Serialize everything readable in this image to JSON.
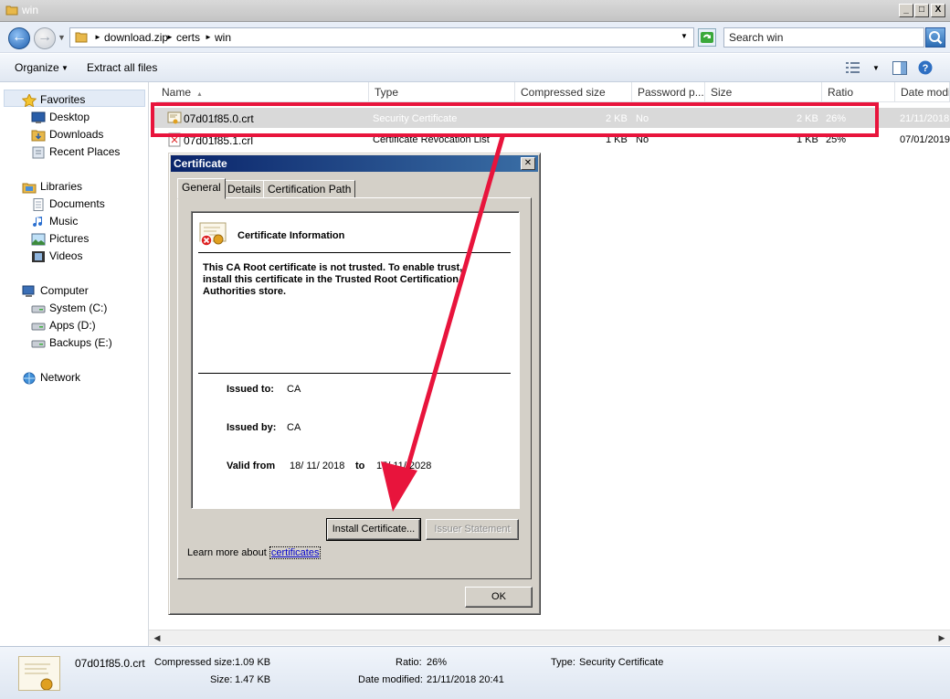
{
  "window": {
    "title": "win"
  },
  "window_controls": {
    "minimize": "_",
    "maximize": "□",
    "close": "X"
  },
  "address": {
    "crumbs": [
      "download.zip",
      "certs",
      "win"
    ],
    "search_placeholder": "Search win"
  },
  "toolbar": {
    "organize": "Organize",
    "extract": "Extract all files"
  },
  "nav": {
    "favorites": "Favorites",
    "favorites_items": [
      "Desktop",
      "Downloads",
      "Recent Places"
    ],
    "libraries": "Libraries",
    "libraries_items": [
      "Documents",
      "Music",
      "Pictures",
      "Videos"
    ],
    "computer": "Computer",
    "computer_items": [
      "System (C:)",
      "Apps (D:)",
      "Backups (E:)"
    ],
    "network": "Network"
  },
  "columns": [
    "Name",
    "Type",
    "Compressed size",
    "Password p...",
    "Size",
    "Ratio",
    "Date modif"
  ],
  "files": [
    {
      "name": "07d01f85.0.crt",
      "type": "Security Certificate",
      "compressed": "2 KB",
      "password": "No",
      "size": "2 KB",
      "ratio": "26%",
      "date": "21/11/2018"
    },
    {
      "name": "07d01f85.1.crl",
      "type": "Certificate Revocation List",
      "compressed": "1 KB",
      "password": "No",
      "size": "1 KB",
      "ratio": "25%",
      "date": "07/01/2019"
    }
  ],
  "details": {
    "filename": "07d01f85.0.crt",
    "compressed_label": "Compressed size:",
    "compressed": "1.09 KB",
    "size_label": "Size:",
    "size": "1.47 KB",
    "ratio_label": "Ratio:",
    "ratio": "26%",
    "date_label": "Date modified:",
    "date": "21/11/2018 20:41",
    "type_label": "Type:",
    "type": "Security Certificate"
  },
  "dialog": {
    "title": "Certificate",
    "tabs": [
      "General",
      "Details",
      "Certification Path"
    ],
    "info_heading": "Certificate Information",
    "warning_lines": [
      "This CA Root certificate is not trusted. To enable trust,",
      "install this certificate in the Trusted Root Certification",
      "Authorities store."
    ],
    "issued_to_label": "Issued to:",
    "issued_to": "CA",
    "issued_by_label": "Issued by:",
    "issued_by": "CA",
    "valid_from_label": "Valid from",
    "valid_from": "18/ 11/ 2018",
    "valid_to_label": "to",
    "valid_to": "15/ 11/ 2028",
    "install_button": "Install Certificate...",
    "issuer_button": "Issuer Statement",
    "learn_more": "Learn more about",
    "learn_more_link": "certificates",
    "ok_button": "OK"
  },
  "annotation": {
    "color": "#e8143c"
  }
}
